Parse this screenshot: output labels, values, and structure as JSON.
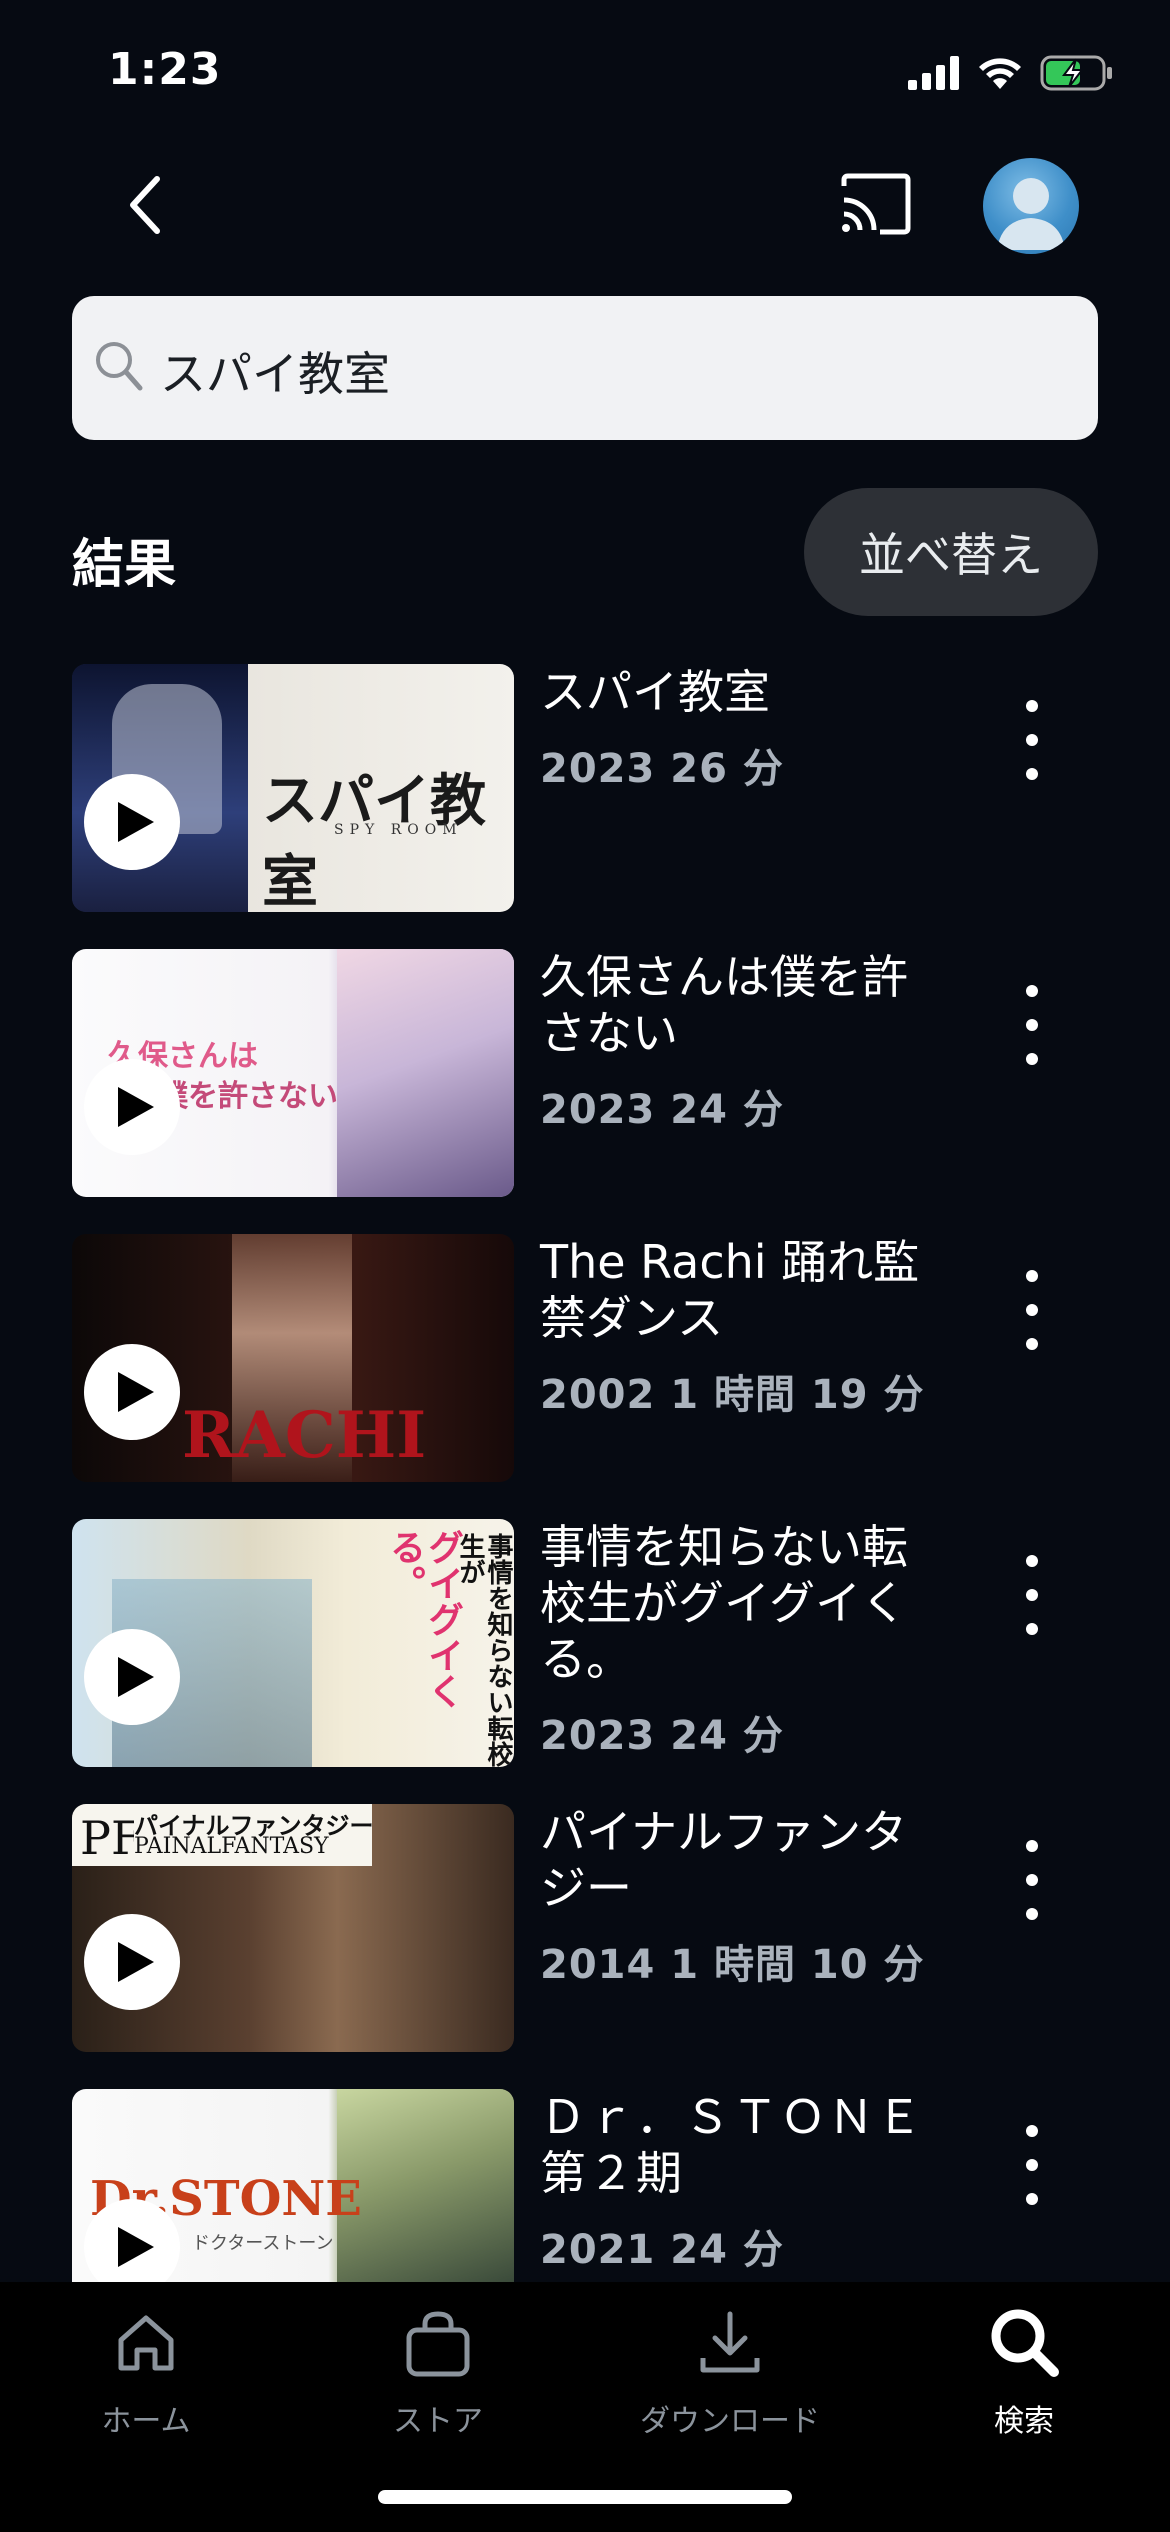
{
  "status": {
    "time": "1:23"
  },
  "search": {
    "query": "スパイ教室"
  },
  "results": {
    "title": "結果",
    "sort_label": "並べ替え"
  },
  "items": [
    {
      "title": "スパイ教室",
      "meta": "2023 26 分",
      "thumb_text": "スパイ教室",
      "thumb_sub": "SPY ROOM"
    },
    {
      "title": "久保さんは僕を許さない",
      "meta": "2023 24 分",
      "thumb_text": "久保さんは",
      "thumb_sub": "僕を許さない"
    },
    {
      "title": "The Rachi 踊れ監禁ダンス",
      "meta": "2002 1 時間 19 分",
      "thumb_text": "RACHI"
    },
    {
      "title": "事情を知らない転校生がグイグイくる。",
      "meta": "2023 24 分",
      "thumb_text": "事情を知らない転校生が",
      "thumb_sub": "グイグイくる。"
    },
    {
      "title": "パイナルファンタジー",
      "meta": "2014 1 時間 10 分",
      "thumb_text": "パイナルファンタジー",
      "thumb_sub": "PAINALFANTASY"
    },
    {
      "title": "Ｄｒ．ＳＴＯＮＥ 第２期",
      "meta": "2021 24 分",
      "thumb_text": "Dr.STONE",
      "thumb_sub": "ドクターストーン"
    }
  ],
  "tabs": [
    {
      "label": "ホーム",
      "icon": "home-icon"
    },
    {
      "label": "ストア",
      "icon": "store-bag-icon"
    },
    {
      "label": "ダウンロード",
      "icon": "download-icon"
    },
    {
      "label": "検索",
      "icon": "search-icon",
      "active": true
    }
  ]
}
